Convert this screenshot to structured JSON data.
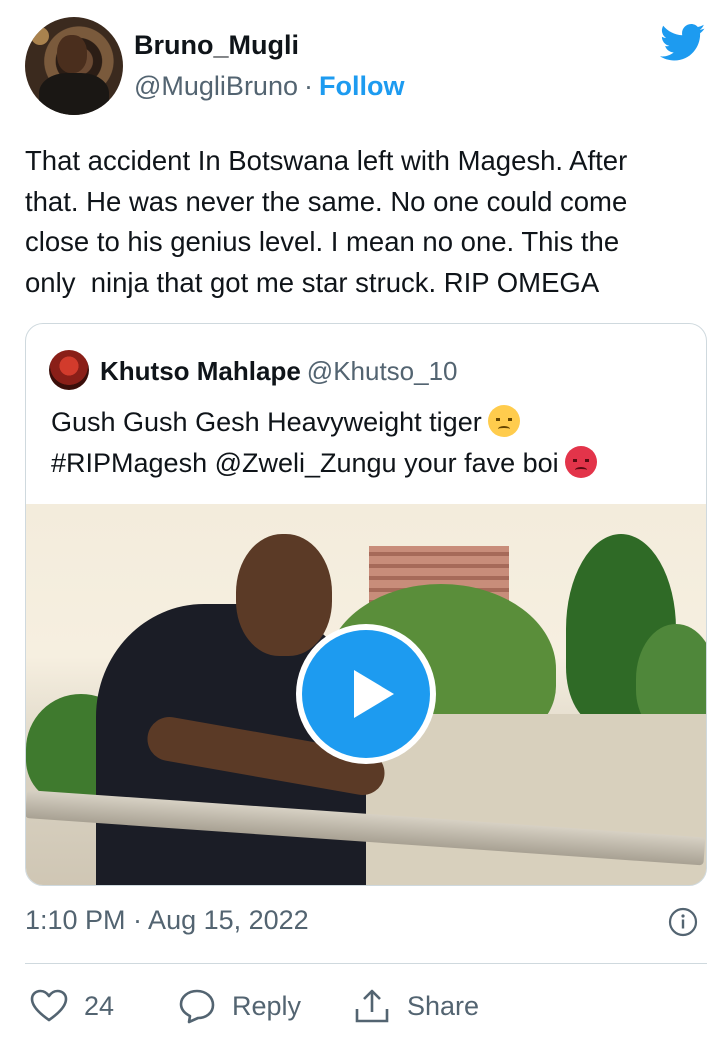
{
  "author": {
    "display_name": "Bruno_Mugli",
    "handle": "@MugliBruno",
    "separator": "·",
    "follow_label": "Follow"
  },
  "tweet": {
    "text": "That accident In Botswana left with Magesh. After\nthat. He was never the same. No one could come\nclose to his genius level. I mean no one. This the\nonly  ninja that got me star struck. RIP OMEGA"
  },
  "quoted_tweet": {
    "display_name": "Khutso Mahlape",
    "handle": "@Khutso_10",
    "line1": "Gush Gush Gesh Heavyweight tiger",
    "line2": "#RIPMagesh @Zweli_Zungu your fave boi",
    "emoji1": "disappointed-face",
    "emoji2": "angry-face"
  },
  "meta": {
    "timestamp": "1:10 PM · Aug 15, 2022"
  },
  "actions": {
    "like_count": "24",
    "reply_label": "Reply",
    "share_label": "Share"
  },
  "colors": {
    "accent": "#1d9bf0",
    "secondary_text": "#536471",
    "border": "#cfd9de"
  }
}
